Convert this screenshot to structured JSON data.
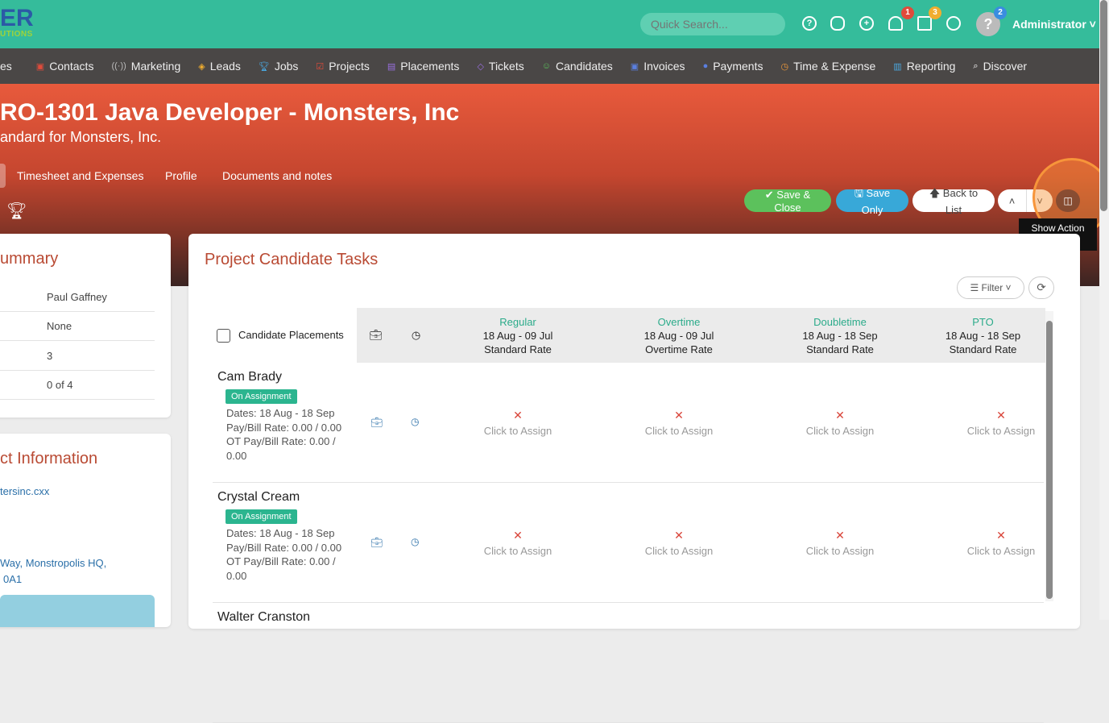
{
  "topbar": {
    "logo_text": "ER",
    "logo_sub": "UTIONS",
    "search_placeholder": "Quick Search...",
    "notifications": "1",
    "flags": "3",
    "user_badge": "2",
    "user": "Administrator"
  },
  "nav": [
    "es",
    "Contacts",
    "Marketing",
    "Leads",
    "Jobs",
    "Projects",
    "Placements",
    "Tickets",
    "Candidates",
    "Invoices",
    "Payments",
    "Time & Expense",
    "Reporting",
    "Discover"
  ],
  "hero": {
    "title": "RO-1301 Java Developer - Monsters, Inc",
    "subtitle": "andard for Monsters, Inc.",
    "tabs": [
      "Timesheet and Expenses",
      "Profile",
      "Documents and notes"
    ]
  },
  "actions": {
    "save_close": "✔ Save & Close",
    "save_only": "🖫 Save Only",
    "back": "🡅 Back to List",
    "up": "˄",
    "down": "˅",
    "tooltip": "Show Action Menu"
  },
  "summary": {
    "title": "ummary",
    "values": [
      "Paul Gaffney",
      "None",
      "3",
      "0 of 4"
    ]
  },
  "contact": {
    "title": "ct Information",
    "email": "tersinc.cxx",
    "address1": "Way, Monstropolis HQ,",
    "address2": "0A1"
  },
  "tasks": {
    "title": "Project Candidate Tasks",
    "filter": "Filter ˅",
    "col_candidates": "Candidate Placements",
    "columns": [
      {
        "type": "Regular",
        "dates": "18 Aug - 09 Jul",
        "rate": "Standard Rate"
      },
      {
        "type": "Overtime",
        "dates": "18 Aug - 09 Jul",
        "rate": "Overtime Rate"
      },
      {
        "type": "Doubletime",
        "dates": "18 Aug - 18 Sep",
        "rate": "Standard Rate"
      },
      {
        "type": "PTO",
        "dates": "18 Aug - 18 Sep",
        "rate": "Standard Rate"
      }
    ],
    "assign": "Click to Assign",
    "x": "✕",
    "rows": [
      {
        "name": "Cam Brady",
        "status": "On Assignment",
        "dates": "Dates: 18 Aug - 18 Sep",
        "pay": "Pay/Bill Rate: 0.00 / 0.00",
        "ot": "OT Pay/Bill Rate: 0.00 / 0.00"
      },
      {
        "name": "Crystal Cream",
        "status": "On Assignment",
        "dates": "Dates: 18 Aug - 18 Sep",
        "pay": "Pay/Bill Rate: 0.00 / 0.00",
        "ot": "OT Pay/Bill Rate: 0.00 / 0.00"
      },
      {
        "name": "Walter Cranston"
      }
    ]
  }
}
